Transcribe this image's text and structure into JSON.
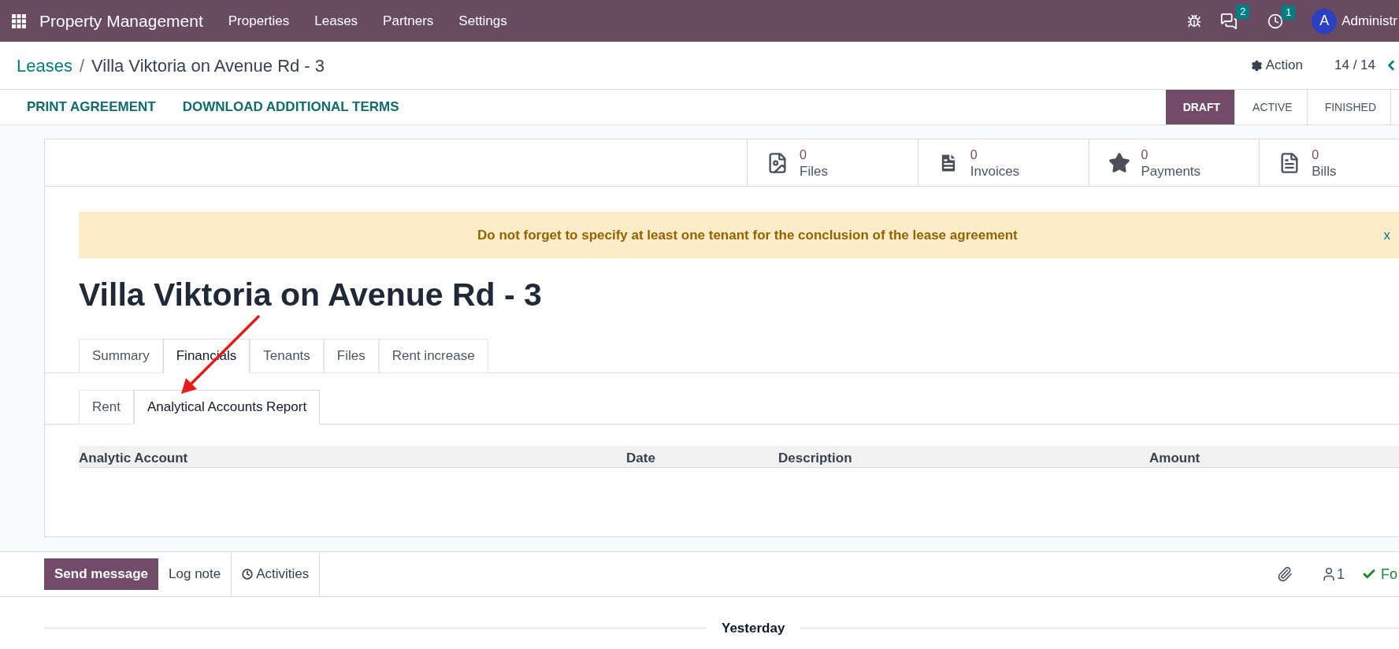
{
  "navbar": {
    "app_title": "Property Management",
    "menu": [
      "Properties",
      "Leases",
      "Partners",
      "Settings"
    ],
    "messages_badge": "2",
    "activities_badge": "1",
    "user_initial": "A",
    "user_name": "Administr"
  },
  "breadcrumb": {
    "parent": "Leases",
    "separator": "/",
    "current": "Villa Viktoria on Avenue Rd - 3"
  },
  "control_panel": {
    "action": "Action",
    "pager": "14 / 14"
  },
  "header_buttons": [
    "PRINT AGREEMENT",
    "DOWNLOAD ADDITIONAL TERMS"
  ],
  "stages": [
    {
      "label": "DRAFT",
      "selected": true
    },
    {
      "label": "ACTIVE",
      "selected": false
    },
    {
      "label": "FINISHED",
      "selected": false
    }
  ],
  "stat_buttons": [
    {
      "kind": "image",
      "count": "0",
      "label": "Files"
    },
    {
      "kind": "invoice",
      "count": "0",
      "label": "Invoices"
    },
    {
      "kind": "star",
      "count": "0",
      "label": "Payments"
    },
    {
      "kind": "document",
      "count": "0",
      "label": "Bills"
    }
  ],
  "alert": {
    "text": "Do not forget to specify at least one tenant for the conclusion of the lease agreement",
    "close": "x"
  },
  "title": "Villa Viktoria on Avenue Rd - 3",
  "tabs": [
    {
      "label": "Summary",
      "selected": false
    },
    {
      "label": "Financials",
      "selected": true
    },
    {
      "label": "Tenants",
      "selected": false
    },
    {
      "label": "Files",
      "selected": false
    },
    {
      "label": "Rent increase",
      "selected": false
    }
  ],
  "subtabs": [
    {
      "label": "Rent",
      "selected": false
    },
    {
      "label": "Analytical Accounts Report",
      "selected": true
    }
  ],
  "table": {
    "columns": [
      "Analytic Account",
      "Date",
      "Description",
      "Amount"
    ]
  },
  "chatter": {
    "buttons": [
      {
        "label": "Send message",
        "selected": true
      },
      {
        "label": "Log note",
        "selected": false
      },
      {
        "label": "Activities",
        "selected": false
      }
    ],
    "followers": "1",
    "follow": "Fo",
    "date_separator": "Yesterday"
  }
}
